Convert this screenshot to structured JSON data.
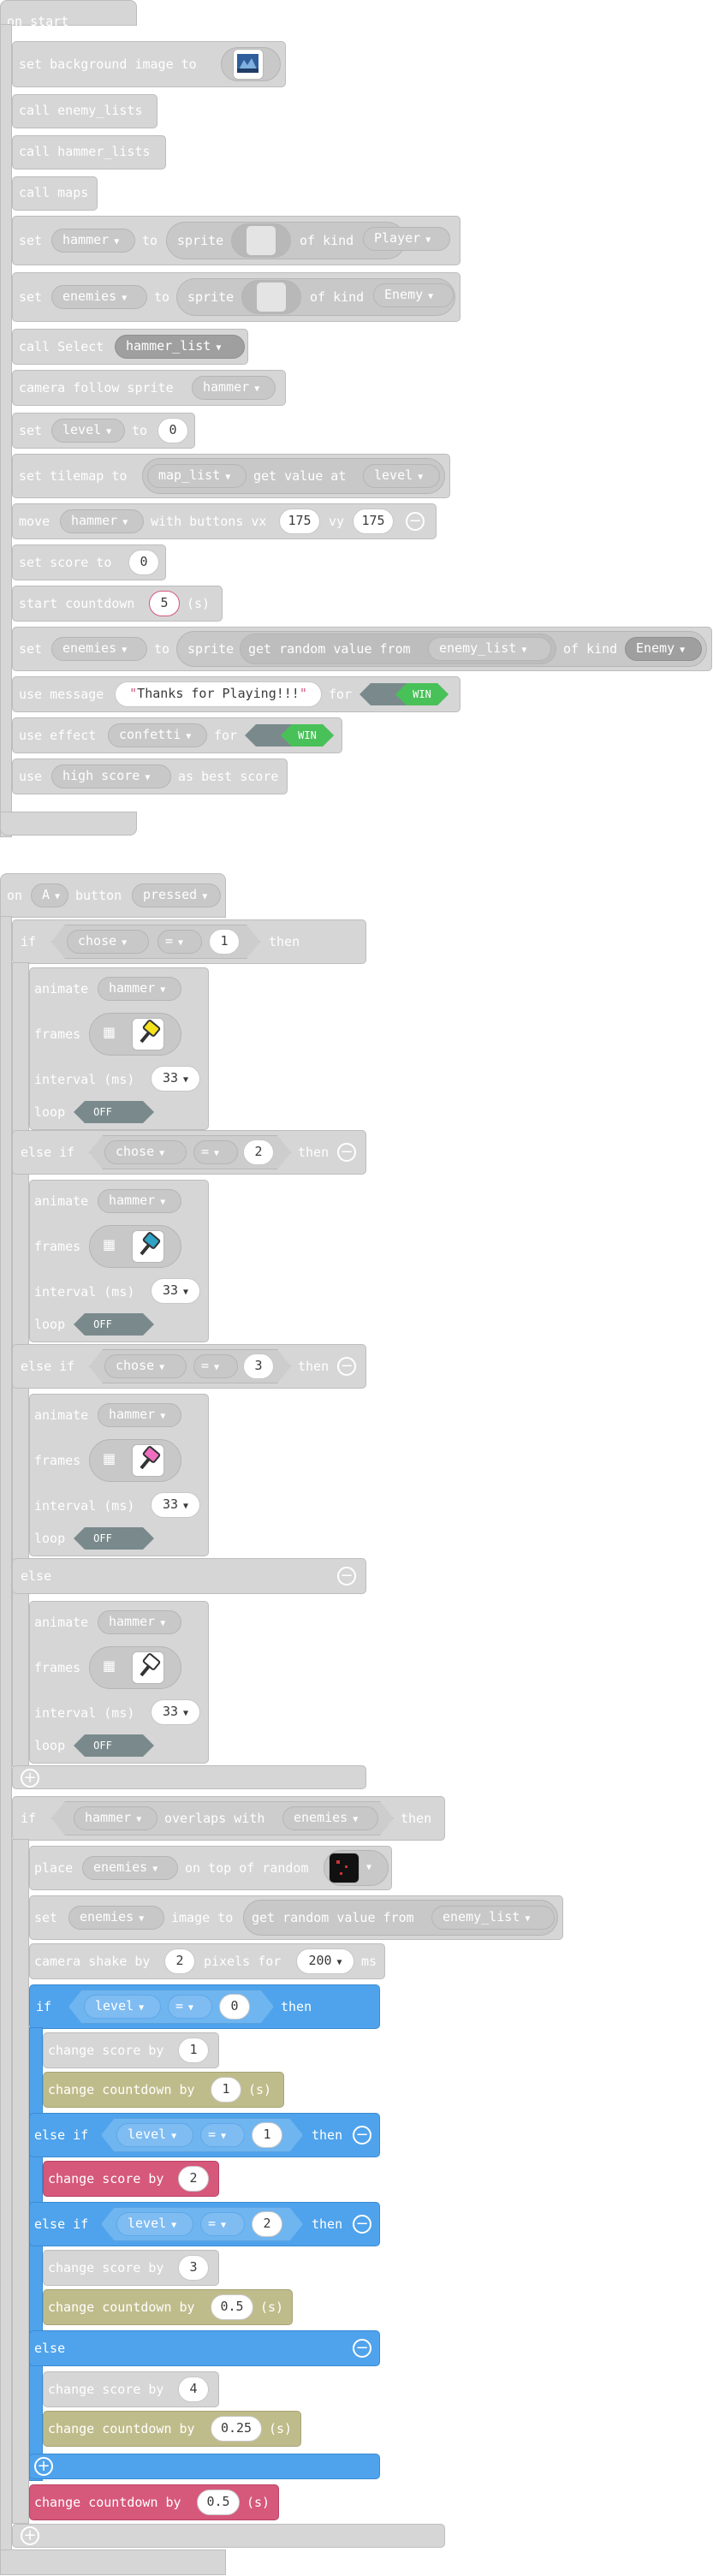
{
  "on_start": {
    "hat": "on start",
    "set_bg": "set background image to",
    "call_enemy_lists": "call enemy_lists",
    "call_hammer_lists": "call hammer_lists",
    "call_maps": "call maps",
    "set_kw": "set",
    "to_kw": "to",
    "sprite_kw": "sprite",
    "of_kind_kw": "of kind",
    "var_hammer": "hammer",
    "kind_player": "Player",
    "var_enemies": "enemies",
    "kind_enemy": "Enemy",
    "call_select": "call Select",
    "hammer_list": "hammer_list",
    "camera_follow": "camera follow sprite",
    "var_level": "level",
    "level_value": "0",
    "set_tilemap": "set tilemap to",
    "map_list": "map_list",
    "get_value_at": "get value at",
    "move_kw": "move",
    "with_buttons": "with buttons vx",
    "vx_value": "175",
    "vy_kw": "vy",
    "vy_value": "175",
    "set_score_to": "set score to",
    "score_value": "0",
    "start_countdown": "start countdown",
    "countdown_value": "5",
    "seconds_unit": "(s)",
    "get_random_from": "get random value from",
    "enemy_list": "enemy_list",
    "use_message": "use message",
    "message_text": "Thanks for Playing!!!",
    "for_kw": "for",
    "win": "WIN",
    "use_effect": "use effect",
    "effect_name": "confetti",
    "use_kw": "use",
    "high_score": "high score",
    "as_best_score": "as best score"
  },
  "on_button": {
    "on_kw": "on",
    "button_a": "A",
    "button_kw": "button",
    "event": "pressed",
    "if_kw": "if",
    "else_if_kw": "else if",
    "else_kw": "else",
    "then_kw": "then",
    "var_chose": "chose",
    "op_eq": "=",
    "val_1": "1",
    "val_2": "2",
    "val_3": "3",
    "animate_kw": "animate",
    "var_hammer": "hammer",
    "frames_kw": "frames",
    "interval_kw": "interval (ms)",
    "interval_value": "33",
    "loop_kw": "loop",
    "off": "OFF",
    "overlaps_with": "overlaps with",
    "var_enemies": "enemies",
    "place_kw": "place",
    "on_top_random": "on top of random",
    "set_kw": "set",
    "image_to": "image to",
    "get_random_from": "get random value from",
    "enemy_list": "enemy_list",
    "camera_shake_by": "camera shake by",
    "shake_value": "2",
    "pixels_for": "pixels for",
    "shake_ms_value": "200",
    "ms_kw": "ms",
    "var_level": "level",
    "val_0": "0",
    "change_score_by": "change score by",
    "change_countdown_by": "change countdown by",
    "score_1": "1",
    "countdown_1": "1",
    "score_2": "2",
    "score_3": "3",
    "countdown_05": "0.5",
    "score_4": "4",
    "countdown_025": "0.25",
    "final_countdown": "0.5",
    "seconds_unit": "(s)"
  },
  "colors": {
    "block_gray": "#d6d6d6",
    "logic_blue": "#4fa3ec",
    "info_olive": "#bfbc8b",
    "score_pink": "#d6587b",
    "toggle_off": "#7a8a8c",
    "toggle_win": "#49c159"
  },
  "icons": [
    "background-thumbnail-icon",
    "blank-sprite-icon",
    "filmstrip-icon",
    "yellow-hammer-icon",
    "blue-hammer-icon",
    "pink-hammer-icon",
    "white-hammer-icon",
    "tile-picker-icon",
    "plus-icon",
    "minus-icon"
  ]
}
